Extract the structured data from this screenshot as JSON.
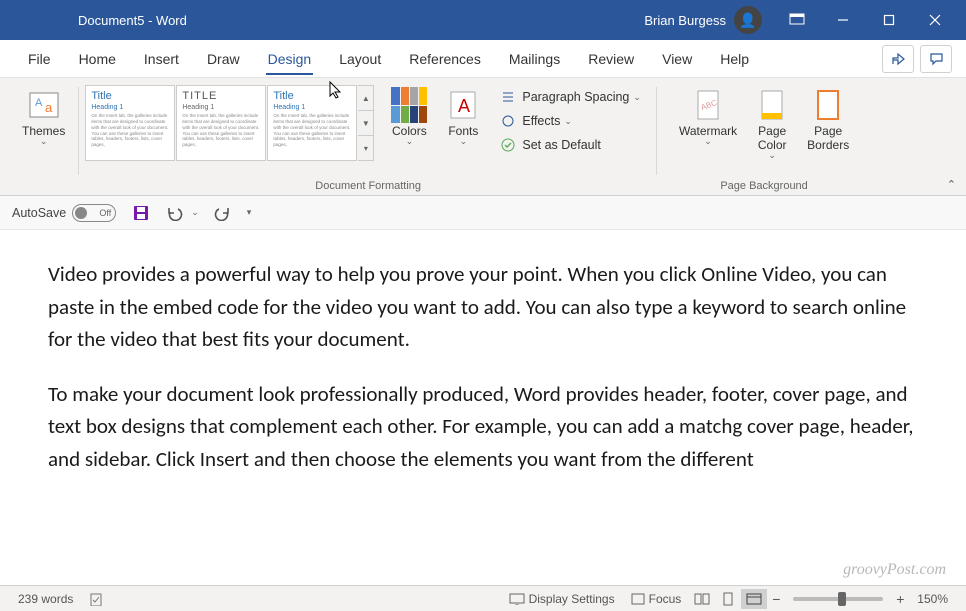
{
  "titlebar": {
    "document": "Document5  -  Word",
    "user": "Brian Burgess"
  },
  "tabs": [
    "File",
    "Home",
    "Insert",
    "Draw",
    "Design",
    "Layout",
    "References",
    "Mailings",
    "Review",
    "View",
    "Help"
  ],
  "active_tab": "Design",
  "ribbon": {
    "themes": "Themes",
    "doc_formatting_label": "Document Formatting",
    "page_background_label": "Page Background",
    "styles": [
      {
        "title": "Title",
        "heading": "Heading 1"
      },
      {
        "title": "TITLE",
        "heading": "Heading 1"
      },
      {
        "title": "Title",
        "heading": "Heading 1"
      }
    ],
    "style_desc": "On the Insert tab, the galleries include items that are designed to coordinate with the overall look of your document. You can use these galleries to insert tables, headers, footers, lists, cover pages,",
    "colors": "Colors",
    "fonts": "Fonts",
    "paragraph_spacing": "Paragraph Spacing",
    "effects": "Effects",
    "set_default": "Set as Default",
    "watermark": "Watermark",
    "page_color": "Page Color",
    "page_borders": "Page Borders"
  },
  "qat": {
    "autosave": "AutoSave",
    "autosave_state": "Off"
  },
  "document": {
    "p1": "Video provides a powerful way to help you prove your point. When you click Online Video, you can paste in the embed code for the video you want to add. You can also type a keyword to search online for the video that best fits your document.",
    "p2": "To make your document look professionally produced, Word provides header, footer, cover page, and text box designs that complement each other. For example, you can add a matchg cover page, header, and sidebar. Click Insert and then choose the elements you want from the different"
  },
  "statusbar": {
    "words": "239 words",
    "display_settings": "Display Settings",
    "focus": "Focus",
    "zoom": "150%"
  },
  "watermark_site": "groovyPost.com",
  "colors_palette": [
    "#4472c4",
    "#ed7d31",
    "#a5a5a5",
    "#ffc000",
    "#5b9bd5",
    "#70ad47",
    "#264478",
    "#9e480e"
  ]
}
